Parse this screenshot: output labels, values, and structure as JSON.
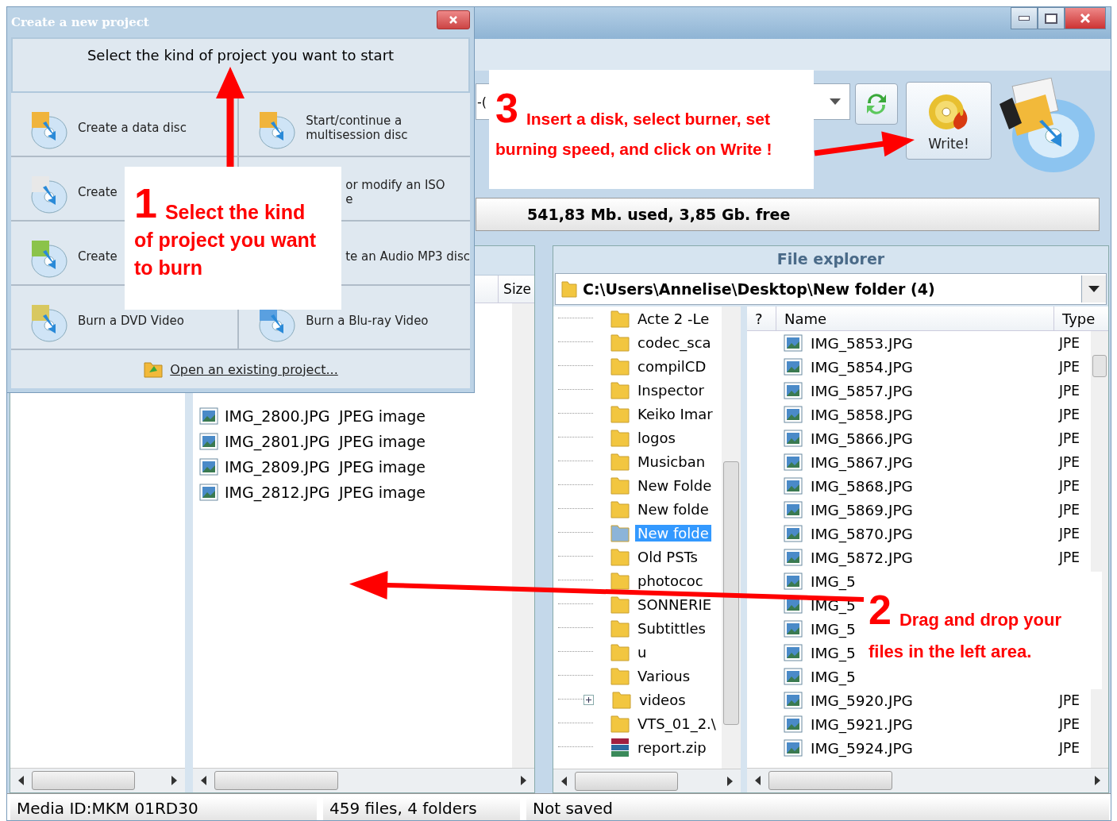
{
  "dialog": {
    "title": "Create a new project",
    "heading": "Select the kind of project you want to start",
    "options": [
      {
        "lines": [
          "Create a data disc"
        ],
        "kind": "data"
      },
      {
        "lines": [
          "Start/continue a",
          "multisession disc"
        ],
        "kind": "multisession"
      },
      {
        "lines": [
          "Create"
        ],
        "kind": "iso"
      },
      {
        "lines": [
          "or modify an ISO",
          "e"
        ]
      },
      {
        "lines": [
          "Create"
        ],
        "kind": "audio"
      },
      {
        "lines": [
          "te an Audio MP3 disc"
        ]
      },
      {
        "lines": [
          "Burn a DVD Video"
        ],
        "kind": "dvd"
      },
      {
        "lines": [
          "Burn a Blu-ray Video"
        ],
        "kind": "bluray"
      }
    ],
    "open_link": "Open an existing project..."
  },
  "toolbar": {
    "drive_value": "-(",
    "write_label": "Write!",
    "capacity": "541,83 Mb. used, 3,85 Gb. free"
  },
  "left_list": {
    "columns": [
      "Size"
    ],
    "rows": [
      {
        "name": "IMG_2800.JPG",
        "type": "JPEG image"
      },
      {
        "name": "IMG_2801.JPG",
        "type": "JPEG image"
      },
      {
        "name": "IMG_2809.JPG",
        "type": "JPEG image"
      },
      {
        "name": "IMG_2812.JPG",
        "type": "JPEG image"
      }
    ]
  },
  "explorer": {
    "title": "File explorer",
    "path": "C:\\Users\\Annelise\\Desktop\\New folder (4)",
    "tree": [
      {
        "label": "Acte 2 -Le",
        "kind": "folder",
        "selected": false,
        "expandable": false
      },
      {
        "label": "codec_sca",
        "kind": "folder",
        "selected": false,
        "expandable": false
      },
      {
        "label": "compilCD",
        "kind": "folder",
        "selected": false,
        "expandable": false
      },
      {
        "label": "Inspector",
        "kind": "folder",
        "selected": false,
        "expandable": false
      },
      {
        "label": "Keiko Imar",
        "kind": "folder",
        "selected": false,
        "expandable": false
      },
      {
        "label": "logos",
        "kind": "folder",
        "selected": false,
        "expandable": false
      },
      {
        "label": "Musicban",
        "kind": "folder",
        "selected": false,
        "expandable": false
      },
      {
        "label": "New Folde",
        "kind": "folder",
        "selected": false,
        "expandable": false
      },
      {
        "label": "New folde",
        "kind": "folder",
        "selected": false,
        "expandable": false
      },
      {
        "label": "New folde",
        "kind": "folder",
        "selected": true,
        "expandable": false
      },
      {
        "label": "Old PSTs",
        "kind": "folder",
        "selected": false,
        "expandable": false
      },
      {
        "label": "photococ",
        "kind": "folder",
        "selected": false,
        "expandable": false
      },
      {
        "label": "SONNERIE",
        "kind": "folder",
        "selected": false,
        "expandable": false
      },
      {
        "label": "Subtittles",
        "kind": "folder",
        "selected": false,
        "expandable": false
      },
      {
        "label": "u",
        "kind": "folder",
        "selected": false,
        "expandable": false
      },
      {
        "label": "Various",
        "kind": "folder",
        "selected": false,
        "expandable": false
      },
      {
        "label": "videos",
        "kind": "folder",
        "selected": false,
        "expandable": true
      },
      {
        "label": "VTS_01_2.\\",
        "kind": "folder",
        "selected": false,
        "expandable": false
      },
      {
        "label": "report.zip",
        "kind": "zip",
        "selected": false,
        "expandable": false
      }
    ],
    "columns": [
      "?",
      "Name",
      "Type"
    ],
    "files": [
      {
        "name": "IMG_5853.JPG",
        "type": "JPE"
      },
      {
        "name": "IMG_5854.JPG",
        "type": "JPE"
      },
      {
        "name": "IMG_5857.JPG",
        "type": "JPE"
      },
      {
        "name": "IMG_5858.JPG",
        "type": "JPE"
      },
      {
        "name": "IMG_5866.JPG",
        "type": "JPE"
      },
      {
        "name": "IMG_5867.JPG",
        "type": "JPE"
      },
      {
        "name": "IMG_5868.JPG",
        "type": "JPE"
      },
      {
        "name": "IMG_5869.JPG",
        "type": "JPE"
      },
      {
        "name": "IMG_5870.JPG",
        "type": "JPE"
      },
      {
        "name": "IMG_5872.JPG",
        "type": "JPE"
      },
      {
        "name": "IMG_5"
      },
      {
        "name": "IMG_5"
      },
      {
        "name": "IMG_5"
      },
      {
        "name": "IMG_5"
      },
      {
        "name": "IMG_5"
      },
      {
        "name": "IMG_5920.JPG",
        "type": "JPE"
      },
      {
        "name": "IMG_5921.JPG",
        "type": "JPE"
      },
      {
        "name": "IMG_5924.JPG",
        "type": "JPE"
      }
    ]
  },
  "status_bar": [
    "Media ID:MKM 01RD30",
    "459 files, 4 folders",
    "Not saved"
  ],
  "callouts": [
    {
      "number": "1",
      "lines": [
        "Select the kind",
        "of project you want",
        "to burn"
      ]
    },
    {
      "number": "2",
      "lines": [
        "Drag and drop your",
        "files in the left area."
      ]
    },
    {
      "number": "3",
      "lines": [
        "Insert a disk, select burner, set",
        "burning speed, and click on Write !"
      ]
    }
  ]
}
